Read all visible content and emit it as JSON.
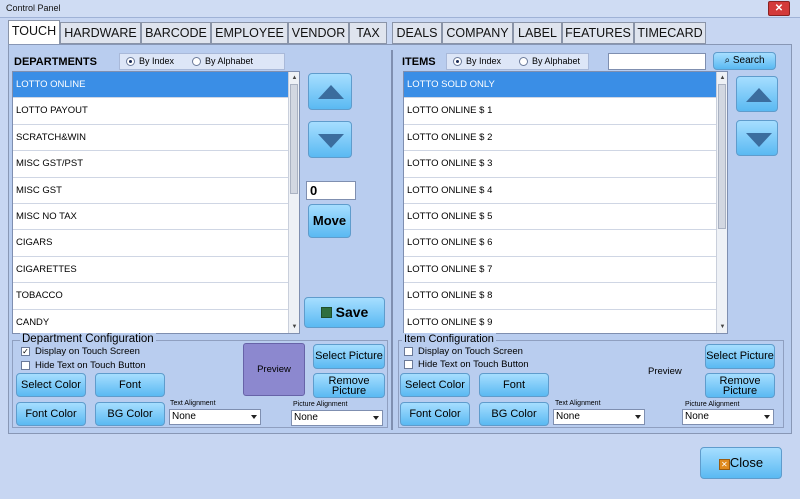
{
  "window": {
    "title": "Control Panel"
  },
  "tabs": [
    "TOUCH",
    "HARDWARE",
    "BARCODE",
    "EMPLOYEE",
    "VENDOR",
    "TAX",
    "DEALS",
    "COMPANY",
    "LABEL",
    "FEATURES",
    "TIMECARD"
  ],
  "departments": {
    "header": "DEPARTMENTS",
    "sort_by_index": "By Index",
    "sort_by_alphabet": "By Alphabet",
    "items": [
      "LOTTO ONLINE",
      "LOTTO PAYOUT",
      "SCRATCH&WIN",
      "MISC GST/PST",
      "MISC GST",
      "MISC NO TAX",
      "CIGARS",
      "CIGARETTES",
      "TOBACCO",
      "CANDY"
    ],
    "move_value": "0",
    "move_label": "Move",
    "save_label": "Save"
  },
  "items": {
    "header": "ITEMS",
    "sort_by_index": "By Index",
    "sort_by_alphabet": "By Alphabet",
    "search_value": "",
    "search_label": "Search",
    "list": [
      "LOTTO SOLD ONLY",
      "LOTTO ONLINE $ 1",
      "LOTTO ONLINE $ 2",
      "LOTTO ONLINE $ 3",
      "LOTTO ONLINE $ 4",
      "LOTTO ONLINE $ 5",
      "LOTTO ONLINE $ 6",
      "LOTTO ONLINE $ 7",
      "LOTTO ONLINE $ 8",
      "LOTTO ONLINE $ 9"
    ]
  },
  "dept_config": {
    "title": "Department Configuration",
    "display_on_touch": "Display on Touch Screen",
    "hide_text": "Hide Text on Touch Button",
    "select_color": "Select Color",
    "font": "Font",
    "font_color": "Font Color",
    "bg_color": "BG Color",
    "text_alignment_label": "Text Alignment",
    "text_alignment_value": "None",
    "picture_alignment_label": "Picture Alignment",
    "picture_alignment_value": "None",
    "preview": "Preview",
    "select_picture": "Select Picture",
    "remove_picture_1": "Remove",
    "remove_picture_2": "Picture"
  },
  "item_config": {
    "title": "Item Configuration",
    "display_on_touch": "Display on Touch Screen",
    "hide_text": "Hide Text on Touch Button",
    "select_color": "Select Color",
    "font": "Font",
    "font_color": "Font Color",
    "bg_color": "BG Color",
    "text_alignment_label": "Text Alignment",
    "text_alignment_value": "None",
    "picture_alignment_label": "Picture Alignment",
    "picture_alignment_value": "None",
    "preview": "Preview",
    "select_picture": "Select Picture",
    "remove_picture_1": "Remove",
    "remove_picture_2": "Picture"
  },
  "footer": {
    "close_label": "Close"
  }
}
